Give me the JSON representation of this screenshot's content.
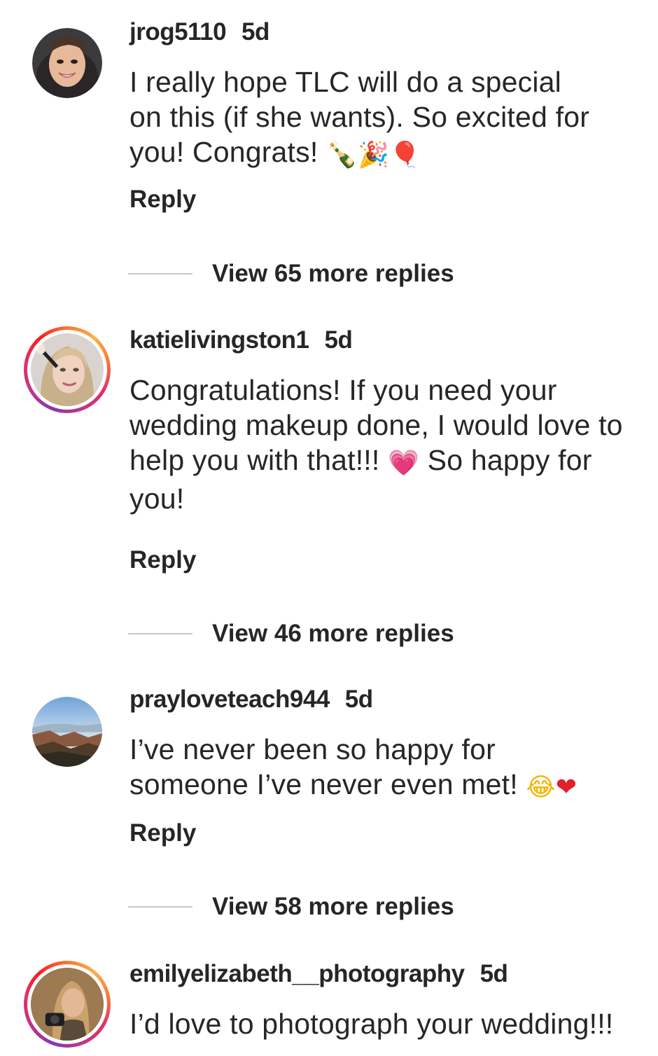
{
  "comments": [
    {
      "username": "jrog5110",
      "time": "5d",
      "text_lines": [
        "I really hope TLC will do a special",
        "on this (if she wants). So excited for",
        "you!  Congrats! "
      ],
      "emojis": [
        "🍾",
        "🎉",
        "🎈"
      ],
      "reply_label": "Reply",
      "view_more": "View 65 more replies",
      "story_ring": false
    },
    {
      "username": "katielivingston1",
      "time": "5d",
      "text_lines": [
        "Congratulations! If you need your",
        "wedding makeup done, I would love to",
        "help you with that!!! ",
        " So happy for",
        "you!"
      ],
      "emojis": [
        "💗"
      ],
      "reply_label": "Reply",
      "view_more": "View 46 more replies",
      "story_ring": true
    },
    {
      "username": "prayloveteach944",
      "time": "5d",
      "text_lines": [
        "I’ve never been so happy for",
        "someone I’ve never even met! "
      ],
      "emojis": [
        "😂",
        "❤"
      ],
      "reply_label": "Reply",
      "view_more": "View 58 more replies",
      "story_ring": false
    },
    {
      "username": "emilyelizabeth__photography",
      "time": "5d",
      "text_lines": [
        "I’d love to photograph your wedding!!!"
      ],
      "emojis": [],
      "story_ring": true
    }
  ],
  "colors": {
    "text": "#262626",
    "divider": "#c7c7c7",
    "story_ring_start": "#833ab4",
    "story_ring_end": "#fcaf45"
  },
  "icons": {
    "comment1_avatar": "woman-smiling-avatar",
    "comment2_avatar": "makeup-artist-avatar",
    "comment3_avatar": "canyon-landscape-avatar",
    "comment4_avatar": "photographer-avatar"
  }
}
